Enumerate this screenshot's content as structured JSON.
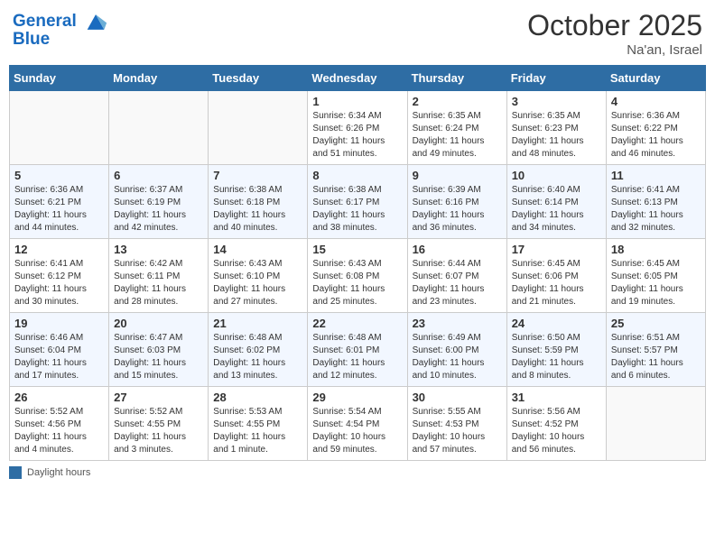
{
  "header": {
    "logo_line1": "General",
    "logo_line2": "Blue",
    "month": "October 2025",
    "location": "Na'an, Israel"
  },
  "days_of_week": [
    "Sunday",
    "Monday",
    "Tuesday",
    "Wednesday",
    "Thursday",
    "Friday",
    "Saturday"
  ],
  "weeks": [
    [
      {
        "day": "",
        "info": ""
      },
      {
        "day": "",
        "info": ""
      },
      {
        "day": "",
        "info": ""
      },
      {
        "day": "1",
        "info": "Sunrise: 6:34 AM\nSunset: 6:26 PM\nDaylight: 11 hours\nand 51 minutes."
      },
      {
        "day": "2",
        "info": "Sunrise: 6:35 AM\nSunset: 6:24 PM\nDaylight: 11 hours\nand 49 minutes."
      },
      {
        "day": "3",
        "info": "Sunrise: 6:35 AM\nSunset: 6:23 PM\nDaylight: 11 hours\nand 48 minutes."
      },
      {
        "day": "4",
        "info": "Sunrise: 6:36 AM\nSunset: 6:22 PM\nDaylight: 11 hours\nand 46 minutes."
      }
    ],
    [
      {
        "day": "5",
        "info": "Sunrise: 6:36 AM\nSunset: 6:21 PM\nDaylight: 11 hours\nand 44 minutes."
      },
      {
        "day": "6",
        "info": "Sunrise: 6:37 AM\nSunset: 6:19 PM\nDaylight: 11 hours\nand 42 minutes."
      },
      {
        "day": "7",
        "info": "Sunrise: 6:38 AM\nSunset: 6:18 PM\nDaylight: 11 hours\nand 40 minutes."
      },
      {
        "day": "8",
        "info": "Sunrise: 6:38 AM\nSunset: 6:17 PM\nDaylight: 11 hours\nand 38 minutes."
      },
      {
        "day": "9",
        "info": "Sunrise: 6:39 AM\nSunset: 6:16 PM\nDaylight: 11 hours\nand 36 minutes."
      },
      {
        "day": "10",
        "info": "Sunrise: 6:40 AM\nSunset: 6:14 PM\nDaylight: 11 hours\nand 34 minutes."
      },
      {
        "day": "11",
        "info": "Sunrise: 6:41 AM\nSunset: 6:13 PM\nDaylight: 11 hours\nand 32 minutes."
      }
    ],
    [
      {
        "day": "12",
        "info": "Sunrise: 6:41 AM\nSunset: 6:12 PM\nDaylight: 11 hours\nand 30 minutes."
      },
      {
        "day": "13",
        "info": "Sunrise: 6:42 AM\nSunset: 6:11 PM\nDaylight: 11 hours\nand 28 minutes."
      },
      {
        "day": "14",
        "info": "Sunrise: 6:43 AM\nSunset: 6:10 PM\nDaylight: 11 hours\nand 27 minutes."
      },
      {
        "day": "15",
        "info": "Sunrise: 6:43 AM\nSunset: 6:08 PM\nDaylight: 11 hours\nand 25 minutes."
      },
      {
        "day": "16",
        "info": "Sunrise: 6:44 AM\nSunset: 6:07 PM\nDaylight: 11 hours\nand 23 minutes."
      },
      {
        "day": "17",
        "info": "Sunrise: 6:45 AM\nSunset: 6:06 PM\nDaylight: 11 hours\nand 21 minutes."
      },
      {
        "day": "18",
        "info": "Sunrise: 6:45 AM\nSunset: 6:05 PM\nDaylight: 11 hours\nand 19 minutes."
      }
    ],
    [
      {
        "day": "19",
        "info": "Sunrise: 6:46 AM\nSunset: 6:04 PM\nDaylight: 11 hours\nand 17 minutes."
      },
      {
        "day": "20",
        "info": "Sunrise: 6:47 AM\nSunset: 6:03 PM\nDaylight: 11 hours\nand 15 minutes."
      },
      {
        "day": "21",
        "info": "Sunrise: 6:48 AM\nSunset: 6:02 PM\nDaylight: 11 hours\nand 13 minutes."
      },
      {
        "day": "22",
        "info": "Sunrise: 6:48 AM\nSunset: 6:01 PM\nDaylight: 11 hours\nand 12 minutes."
      },
      {
        "day": "23",
        "info": "Sunrise: 6:49 AM\nSunset: 6:00 PM\nDaylight: 11 hours\nand 10 minutes."
      },
      {
        "day": "24",
        "info": "Sunrise: 6:50 AM\nSunset: 5:59 PM\nDaylight: 11 hours\nand 8 minutes."
      },
      {
        "day": "25",
        "info": "Sunrise: 6:51 AM\nSunset: 5:57 PM\nDaylight: 11 hours\nand 6 minutes."
      }
    ],
    [
      {
        "day": "26",
        "info": "Sunrise: 5:52 AM\nSunset: 4:56 PM\nDaylight: 11 hours\nand 4 minutes."
      },
      {
        "day": "27",
        "info": "Sunrise: 5:52 AM\nSunset: 4:55 PM\nDaylight: 11 hours\nand 3 minutes."
      },
      {
        "day": "28",
        "info": "Sunrise: 5:53 AM\nSunset: 4:55 PM\nDaylight: 11 hours\nand 1 minute."
      },
      {
        "day": "29",
        "info": "Sunrise: 5:54 AM\nSunset: 4:54 PM\nDaylight: 10 hours\nand 59 minutes."
      },
      {
        "day": "30",
        "info": "Sunrise: 5:55 AM\nSunset: 4:53 PM\nDaylight: 10 hours\nand 57 minutes."
      },
      {
        "day": "31",
        "info": "Sunrise: 5:56 AM\nSunset: 4:52 PM\nDaylight: 10 hours\nand 56 minutes."
      },
      {
        "day": "",
        "info": ""
      }
    ]
  ],
  "legend": {
    "color_label": "Daylight hours"
  }
}
